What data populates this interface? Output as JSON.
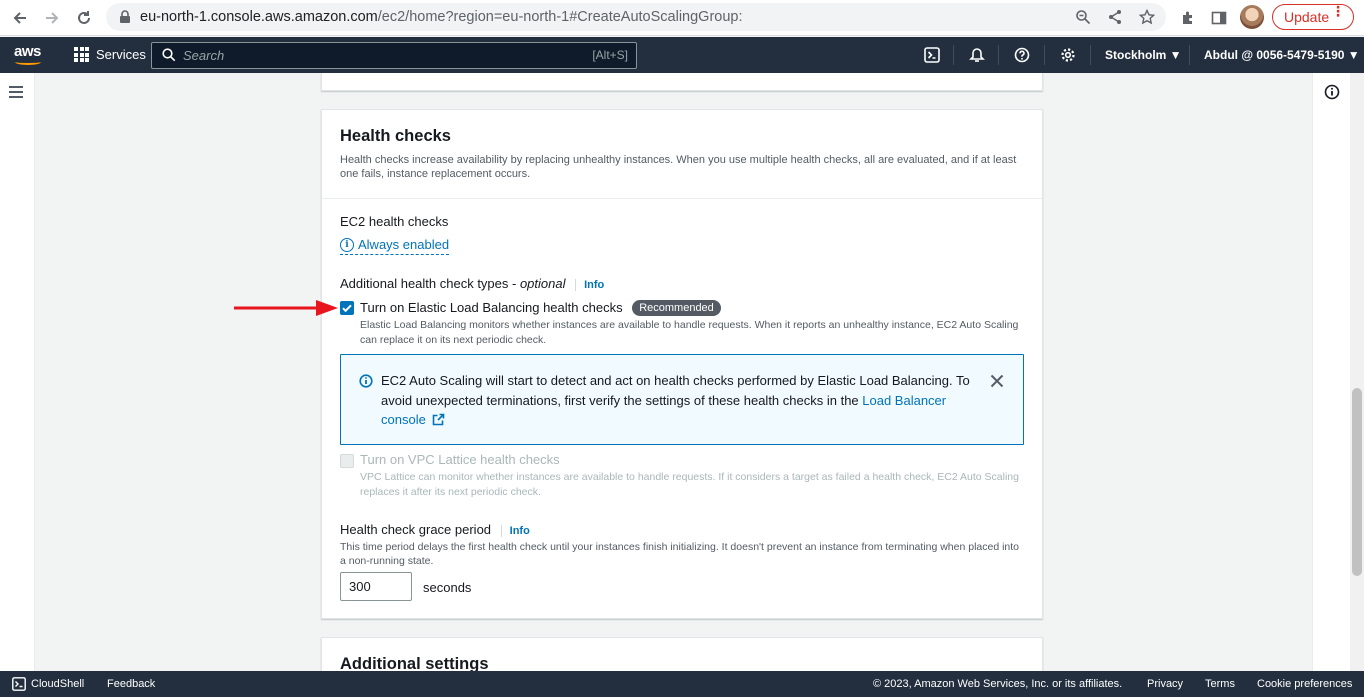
{
  "browser": {
    "url_host": "eu-north-1.console.aws.amazon.com",
    "url_path": "/ec2/home?region=eu-north-1#CreateAutoScalingGroup:",
    "update_label": "Update"
  },
  "aws_nav": {
    "logo": "aws",
    "services_label": "Services",
    "search_placeholder": "Search",
    "search_shortcut": "[Alt+S]",
    "region": "Stockholm ▼",
    "account": "Abdul @ 0056-5479-5190 ▼"
  },
  "health_checks": {
    "title": "Health checks",
    "description": "Health checks increase availability by replacing unhealthy instances. When you use multiple health checks, all are evaluated, and if at least one fails, instance replacement occurs.",
    "ec2_label": "EC2 health checks",
    "ec2_value": "Always enabled",
    "additional_label": "Additional health check types - ",
    "additional_optional": "optional",
    "info": "Info",
    "elb": {
      "label": "Turn on Elastic Load Balancing health checks",
      "badge": "Recommended",
      "checked": true,
      "description": "Elastic Load Balancing monitors whether instances are available to handle requests. When it reports an unhealthy instance, EC2 Auto Scaling can replace it on its next periodic check."
    },
    "alert": {
      "text": "EC2 Auto Scaling will start to detect and act on health checks performed by Elastic Load Balancing. To avoid unexpected terminations, first verify the settings of these health checks in the ",
      "link": "Load Balancer console"
    },
    "vpc": {
      "label": "Turn on VPC Lattice health checks",
      "checked": false,
      "disabled": true,
      "description": "VPC Lattice can monitor whether instances are available to handle requests. If it considers a target as failed a health check, EC2 Auto Scaling replaces it after its next periodic check."
    },
    "grace": {
      "label": "Health check grace period",
      "info": "Info",
      "description": "This time period delays the first health check until your instances finish initializing. It doesn't prevent an instance from terminating when placed into a non-running state.",
      "value": "300",
      "unit": "seconds"
    }
  },
  "additional_settings": {
    "title": "Additional settings"
  },
  "footer": {
    "cloudshell": "CloudShell",
    "feedback": "Feedback",
    "copyright": "© 2023, Amazon Web Services, Inc. or its affiliates.",
    "privacy": "Privacy",
    "terms": "Terms",
    "cookies": "Cookie preferences"
  },
  "colors": {
    "aws_nav": "#232f3e",
    "link": "#0073bb",
    "arrow": "#e8141e",
    "update": "#d93025"
  }
}
